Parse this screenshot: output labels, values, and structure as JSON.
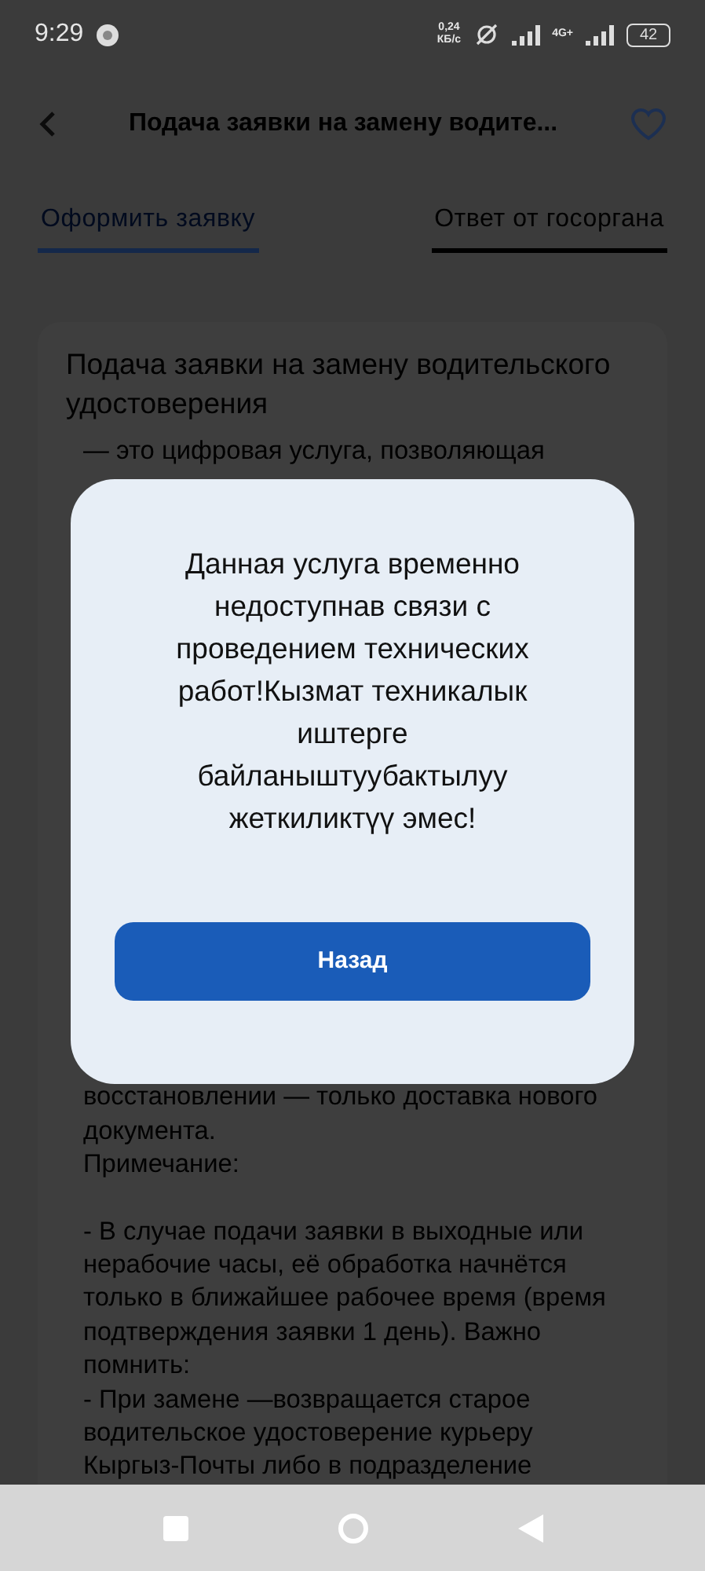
{
  "status_bar": {
    "time": "9:29",
    "speed_value": "0,24",
    "speed_unit": "КБ/с",
    "network": "4G+",
    "battery": "42"
  },
  "header": {
    "title": "Подача заявки на замену водите...",
    "favorite": false
  },
  "tabs": [
    {
      "label": "Оформить заявку",
      "selected": true
    },
    {
      "label": "Ответ от госоргана",
      "selected": false
    }
  ],
  "card": {
    "title": "Подача заявки на замену водительского удостоверения",
    "intro": "— это цифровая услуга, позволяющая",
    "paragraphs": [
      "восстановлении — только доставка нового документа.",
      "Примечание:",
      "- В случае подачи заявки в выходные или нерабочие часы, её обработка начнётся только в ближайшее рабочее время (время подтверждения заявки 1 день). Важно помнить:",
      "- При замене —возвращается старое водительское удостоверение курьеру Кыргыз-Почты либо в подразделение"
    ]
  },
  "dialog": {
    "message": "Данная услуга временно недоступнав связи с проведением технических работ!Кызмат техникалык иштерге байланыштуубактылуу жеткиликтүү эмес!",
    "button": "Назад"
  }
}
